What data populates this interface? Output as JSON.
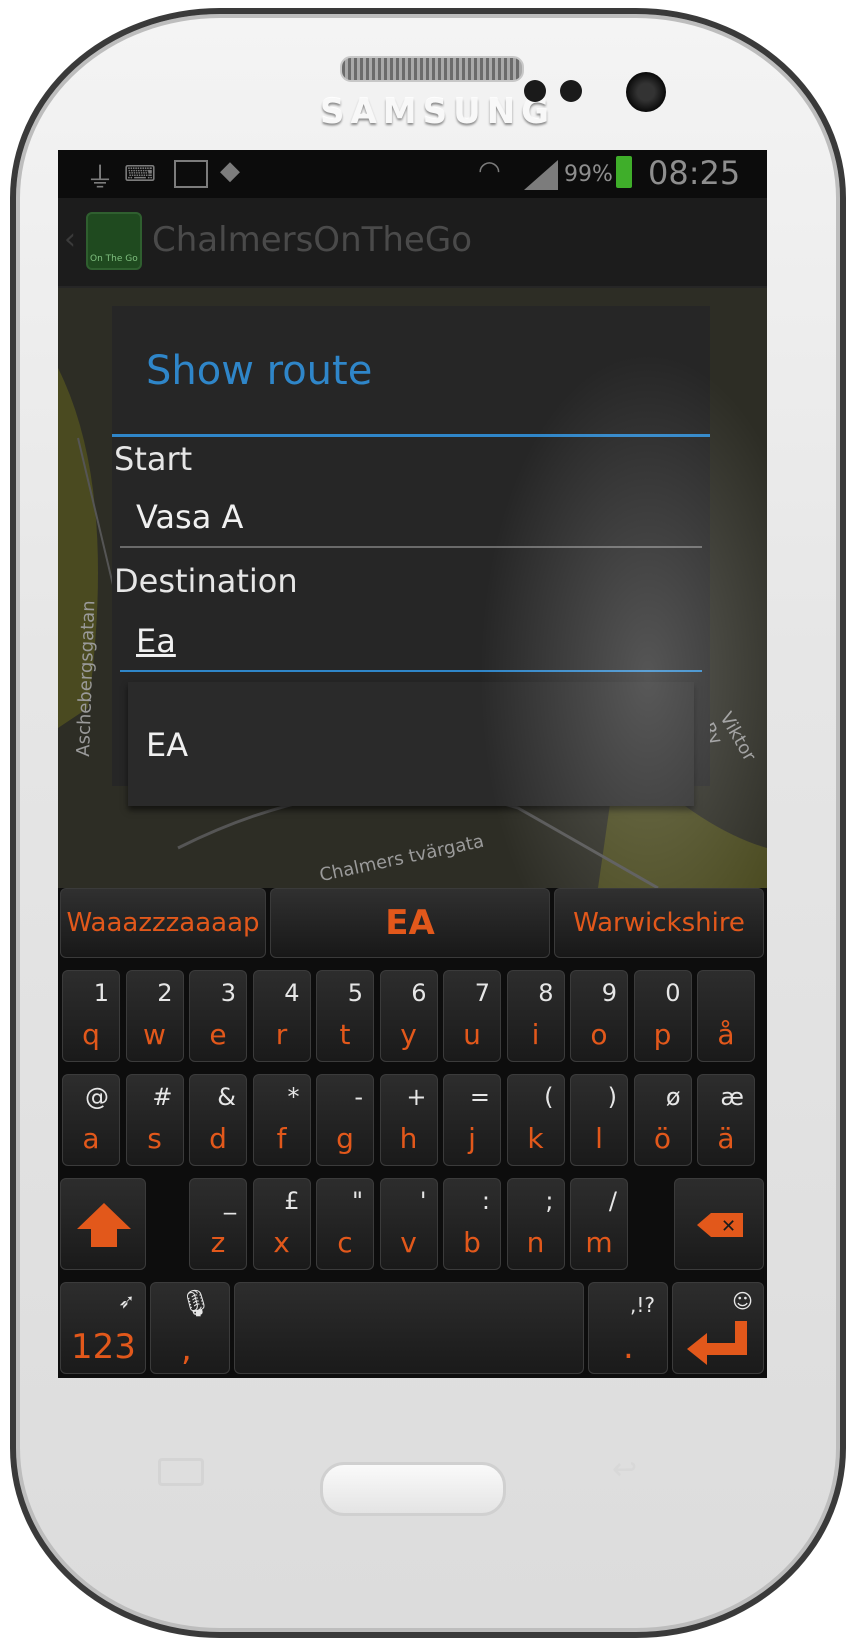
{
  "device": {
    "brand": "SAMSUNG"
  },
  "statusbar": {
    "battery": "99%",
    "time": "08:25"
  },
  "actionbar": {
    "title": "ChalmersOnTheGo",
    "icon_text": "On The Go"
  },
  "map": {
    "street_1": "Aschebergsgatan",
    "street_2": "Chalmers tvärgata",
    "street_3": "Viktor Ry"
  },
  "dialog": {
    "title": "Show route",
    "start_label": "Start",
    "start_value": "Vasa A",
    "destination_label": "Destination",
    "destination_value": "Ea",
    "suggestion": "EA"
  },
  "keyboard": {
    "suggestions": [
      "Waaazzzaaaap",
      "EA",
      "Warwickshire"
    ],
    "row1": [
      {
        "sec": "1",
        "pri": "q"
      },
      {
        "sec": "2",
        "pri": "w"
      },
      {
        "sec": "3",
        "pri": "e"
      },
      {
        "sec": "4",
        "pri": "r"
      },
      {
        "sec": "5",
        "pri": "t"
      },
      {
        "sec": "6",
        "pri": "y"
      },
      {
        "sec": "7",
        "pri": "u"
      },
      {
        "sec": "8",
        "pri": "i"
      },
      {
        "sec": "9",
        "pri": "o"
      },
      {
        "sec": "0",
        "pri": "p"
      },
      {
        "sec": "",
        "pri": "å"
      }
    ],
    "row2": [
      {
        "sec": "@",
        "pri": "a"
      },
      {
        "sec": "#",
        "pri": "s"
      },
      {
        "sec": "&",
        "pri": "d"
      },
      {
        "sec": "*",
        "pri": "f"
      },
      {
        "sec": "-",
        "pri": "g"
      },
      {
        "sec": "+",
        "pri": "h"
      },
      {
        "sec": "=",
        "pri": "j"
      },
      {
        "sec": "(",
        "pri": "k"
      },
      {
        "sec": ")",
        "pri": "l"
      },
      {
        "sec": "ø",
        "pri": "ö"
      },
      {
        "sec": "æ",
        "pri": "ä"
      }
    ],
    "row3": [
      {
        "sec": "_",
        "pri": "z"
      },
      {
        "sec": "£",
        "pri": "x"
      },
      {
        "sec": "\"",
        "pri": "c"
      },
      {
        "sec": "'",
        "pri": "v"
      },
      {
        "sec": ":",
        "pri": "b"
      },
      {
        "sec": ";",
        "pri": "n"
      },
      {
        "sec": "/",
        "pri": "m"
      }
    ],
    "num_key": "123",
    "comma_key": ",",
    "punct_secondary": ",!?",
    "punct_primary": ".",
    "smiley": "☺"
  },
  "colors": {
    "accent_blue": "#2f86c9",
    "keyboard_orange": "#e2581b"
  }
}
